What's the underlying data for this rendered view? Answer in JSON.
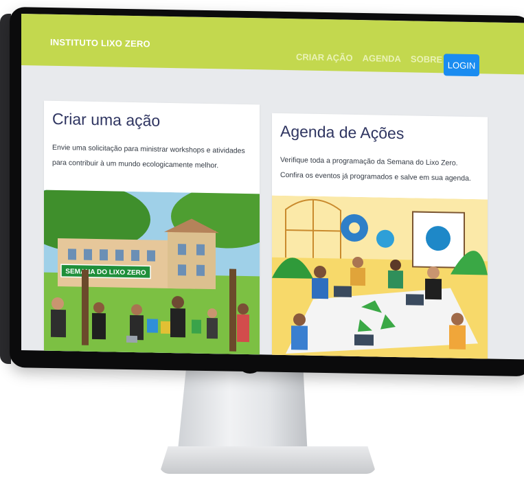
{
  "navbar": {
    "brand": "INSTITUTO LIXO ZERO",
    "links": [
      "CRIAR AÇÃO",
      "AGENDA",
      "SOBRE"
    ],
    "login_label": "LOGIN"
  },
  "cards": [
    {
      "title": "Criar uma ação",
      "text": "Envie uma solicitação para ministrar workshops e atividades para contribuir à um mundo ecologicamente melhor.",
      "banner_text": "SEMANA DO LIXO ZERO"
    },
    {
      "title": "Agenda de Ações",
      "text": "Verifique toda a programação da Semana do Lixo Zero. Confira os eventos já programados e salve em sua agenda."
    }
  ],
  "colors": {
    "navbar": "#c3d84e",
    "login": "#1a8cf0",
    "title": "#2f3561",
    "page_bg": "#e8eaed"
  }
}
